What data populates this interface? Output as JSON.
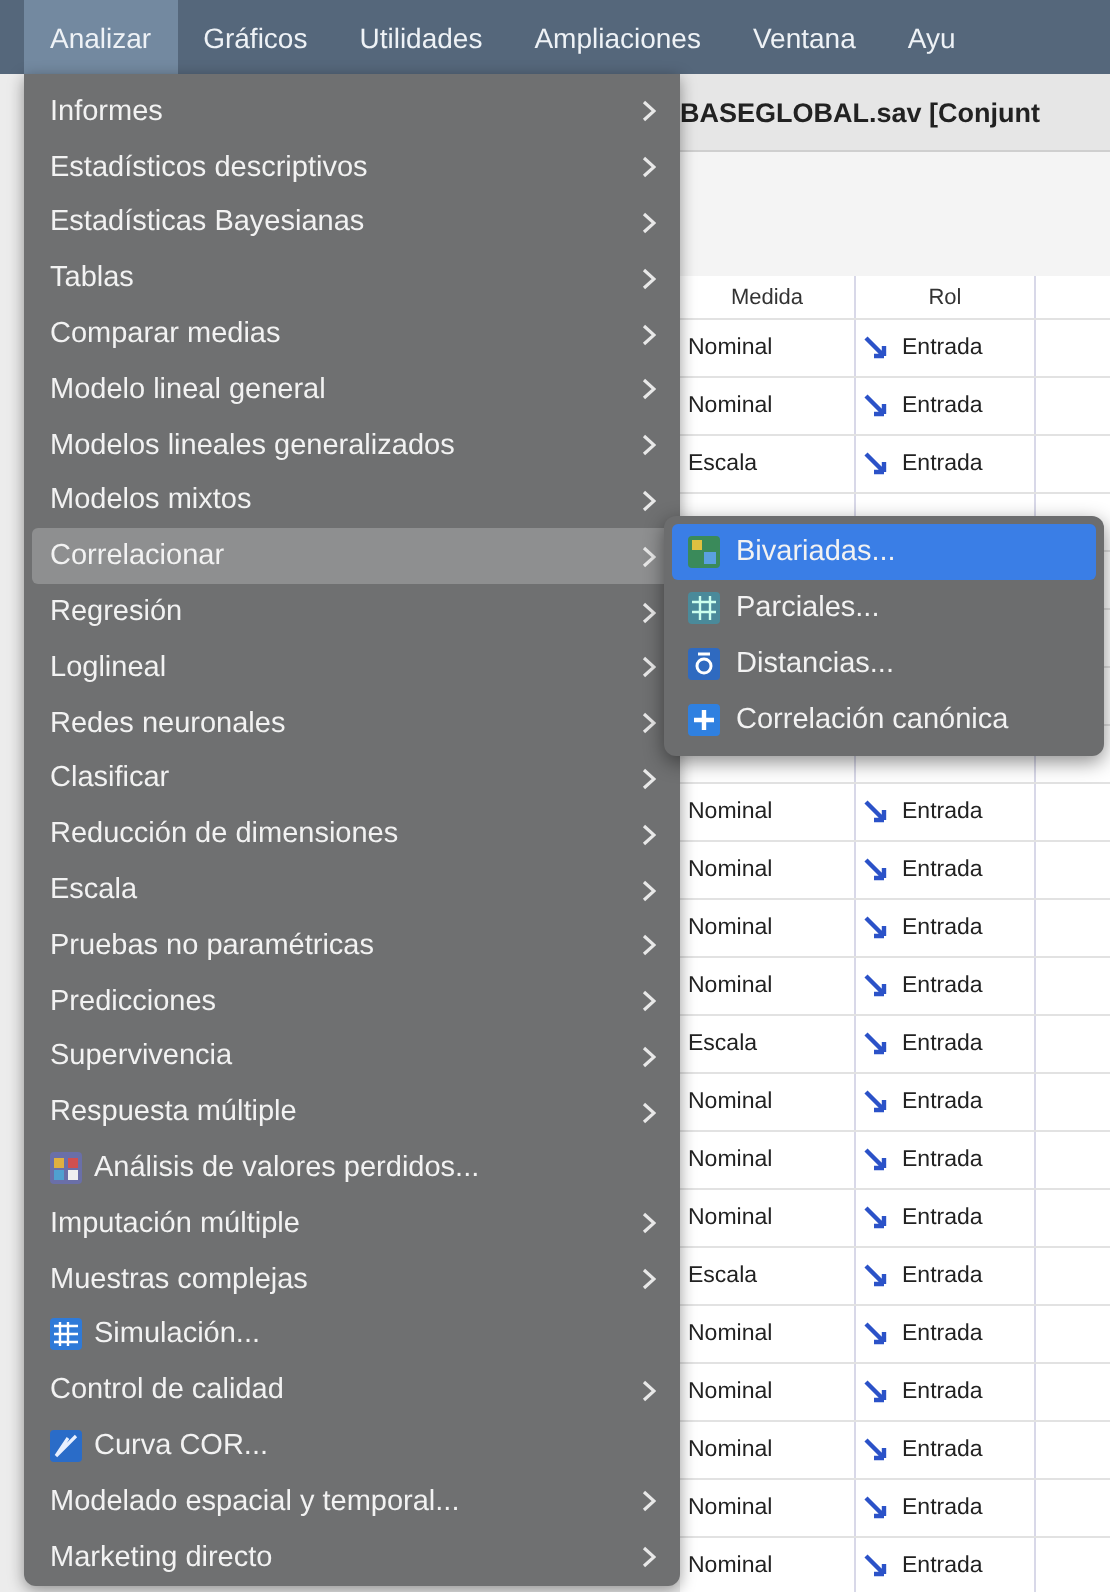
{
  "menubar": [
    {
      "label": "Analizar",
      "selected": true
    },
    {
      "label": "Gráficos",
      "selected": false
    },
    {
      "label": "Utilidades",
      "selected": false
    },
    {
      "label": "Ampliaciones",
      "selected": false
    },
    {
      "label": "Ventana",
      "selected": false
    },
    {
      "label": "Ayu",
      "selected": false
    }
  ],
  "window": {
    "title": "BASEGLOBAL.sav [Conjunt"
  },
  "table": {
    "columns": [
      "Medida",
      "Rol"
    ],
    "rows_top": [
      {
        "medida": "Nominal",
        "rol": "Entrada"
      },
      {
        "medida": "Nominal",
        "rol": "Entrada"
      },
      {
        "medida": "Escala",
        "rol": "Entrada"
      }
    ],
    "rows_bottom": [
      {
        "medida": "Nominal",
        "rol": "Entrada"
      },
      {
        "medida": "Nominal",
        "rol": "Entrada"
      },
      {
        "medida": "Nominal",
        "rol": "Entrada"
      },
      {
        "medida": "Nominal",
        "rol": "Entrada"
      },
      {
        "medida": "Escala",
        "rol": "Entrada"
      },
      {
        "medida": "Nominal",
        "rol": "Entrada"
      },
      {
        "medida": "Nominal",
        "rol": "Entrada"
      },
      {
        "medida": "Nominal",
        "rol": "Entrada"
      },
      {
        "medida": "Escala",
        "rol": "Entrada"
      },
      {
        "medida": "Nominal",
        "rol": "Entrada"
      },
      {
        "medida": "Nominal",
        "rol": "Entrada"
      },
      {
        "medida": "Nominal",
        "rol": "Entrada"
      },
      {
        "medida": "Nominal",
        "rol": "Entrada"
      },
      {
        "medida": "Nominal",
        "rol": "Entrada"
      }
    ]
  },
  "menu": {
    "items": [
      {
        "label": "Informes",
        "kind": "submenu",
        "selected": false
      },
      {
        "label": "Estadísticos descriptivos",
        "kind": "submenu",
        "selected": false
      },
      {
        "label": "Estadísticas Bayesianas",
        "kind": "submenu",
        "selected": false
      },
      {
        "label": "Tablas",
        "kind": "submenu",
        "selected": false
      },
      {
        "label": "Comparar medias",
        "kind": "submenu",
        "selected": false
      },
      {
        "label": "Modelo lineal general",
        "kind": "submenu",
        "selected": false
      },
      {
        "label": "Modelos lineales generalizados",
        "kind": "submenu",
        "selected": false
      },
      {
        "label": "Modelos mixtos",
        "kind": "submenu",
        "selected": false
      },
      {
        "label": "Correlacionar",
        "kind": "submenu",
        "selected": true
      },
      {
        "label": "Regresión",
        "kind": "submenu",
        "selected": false
      },
      {
        "label": "Loglineal",
        "kind": "submenu",
        "selected": false
      },
      {
        "label": "Redes neuronales",
        "kind": "submenu",
        "selected": false
      },
      {
        "label": "Clasificar",
        "kind": "submenu",
        "selected": false
      },
      {
        "label": "Reducción de dimensiones",
        "kind": "submenu",
        "selected": false
      },
      {
        "label": "Escala",
        "kind": "submenu",
        "selected": false
      },
      {
        "label": "Pruebas no paramétricas",
        "kind": "submenu",
        "selected": false
      },
      {
        "label": "Predicciones",
        "kind": "submenu",
        "selected": false
      },
      {
        "label": "Supervivencia",
        "kind": "submenu",
        "selected": false
      },
      {
        "label": "Respuesta múltiple",
        "kind": "submenu",
        "selected": false
      },
      {
        "label": "Análisis de valores perdidos...",
        "kind": "dialog",
        "selected": false
      },
      {
        "label": "Imputación múltiple",
        "kind": "submenu",
        "selected": false
      },
      {
        "label": "Muestras complejas",
        "kind": "submenu",
        "selected": false
      },
      {
        "label": "Simulación...",
        "kind": "dialog",
        "selected": false
      },
      {
        "label": "Control de calidad",
        "kind": "submenu",
        "selected": false
      },
      {
        "label": "Curva COR...",
        "kind": "dialog",
        "selected": false
      },
      {
        "label": "Modelado espacial y temporal...",
        "kind": "submenu",
        "selected": false
      },
      {
        "label": "Marketing directo",
        "kind": "submenu",
        "selected": false
      }
    ]
  },
  "submenu": {
    "items": [
      {
        "label": "Bivariadas...",
        "selected": true
      },
      {
        "label": "Parciales...",
        "selected": false
      },
      {
        "label": "Distancias...",
        "selected": false
      },
      {
        "label": "Correlación canónica",
        "selected": false
      }
    ]
  }
}
